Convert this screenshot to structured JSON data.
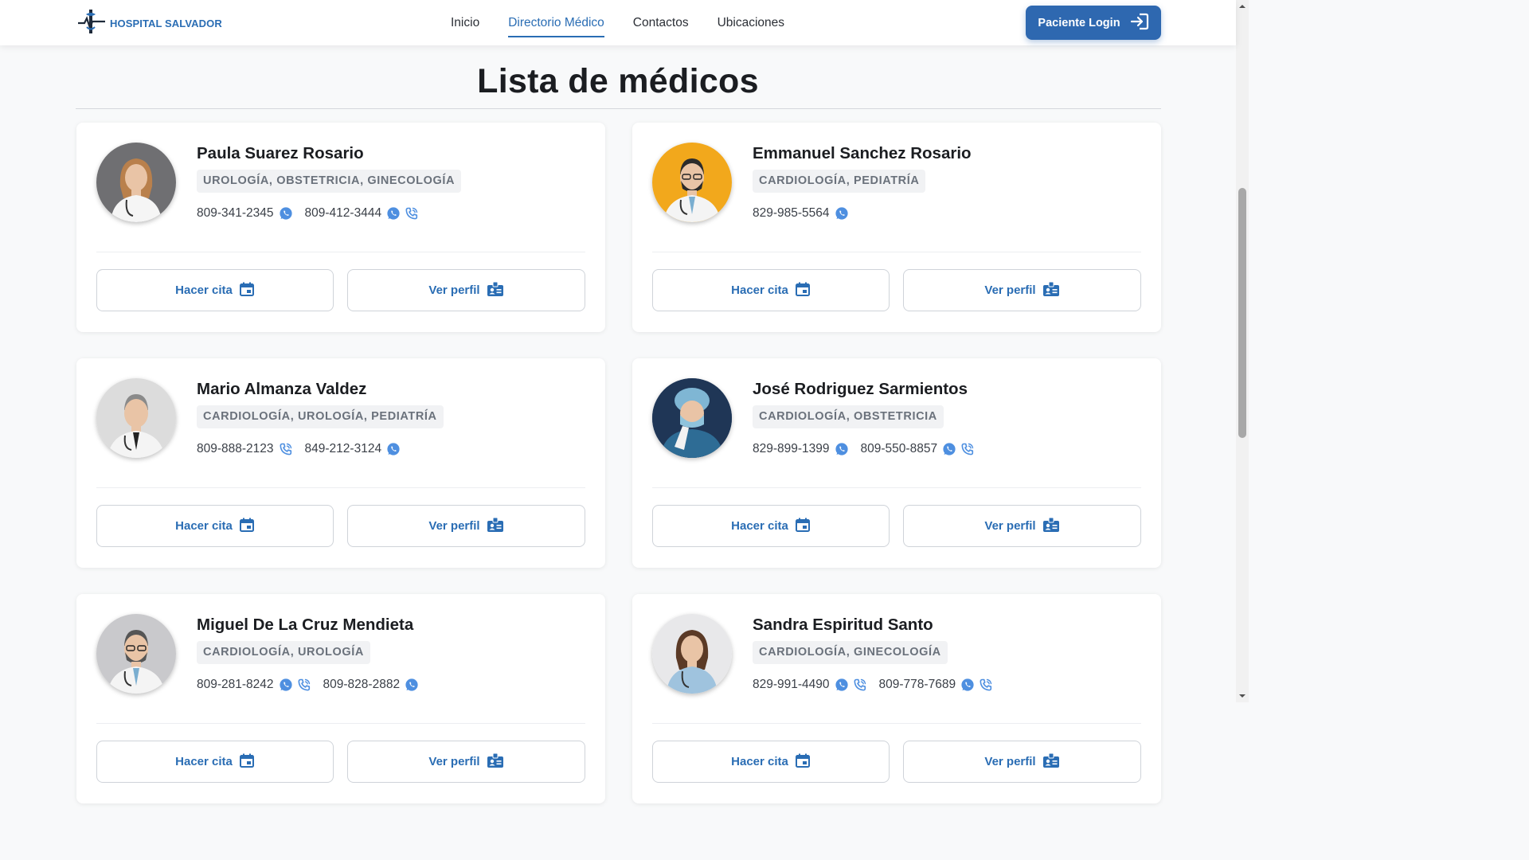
{
  "brand": {
    "name": "HOSPITAL SALVADOR",
    "color": "#2a6db4"
  },
  "nav": [
    {
      "label": "Inicio",
      "active": false
    },
    {
      "label": "Directorio Médico",
      "active": true
    },
    {
      "label": "Contactos",
      "active": false
    },
    {
      "label": "Ubicaciones",
      "active": false
    }
  ],
  "login": {
    "label": "Paciente Login",
    "icon": "login-arrow-icon"
  },
  "page": {
    "title": "Lista de médicos"
  },
  "buttons": {
    "cita": "Hacer cita",
    "perfil": "Ver perfil"
  },
  "doctors": [
    {
      "name": "Paula Suarez Rosario",
      "specialties": "UROLOGÍA, OBSTETRICIA, GINECOLOGÍA",
      "phones": [
        {
          "number": "809-341-2345",
          "icons": [
            "whatsapp"
          ]
        },
        {
          "number": "809-412-3444",
          "icons": [
            "whatsapp",
            "phone"
          ]
        }
      ],
      "avatar": "female-doctor",
      "avatar_bg": "#6f6f72"
    },
    {
      "name": "Emmanuel Sanchez Rosario",
      "specialties": "CARDIOLOGÍA, PEDIATRÍA",
      "phones": [
        {
          "number": "829-985-5564",
          "icons": [
            "whatsapp"
          ]
        }
      ],
      "avatar": "male-doctor-beard",
      "avatar_bg": "#f2a81c"
    },
    {
      "name": "Mario Almanza Valdez",
      "specialties": "CARDIOLOGÍA, UROLOGÍA, PEDIATRÍA",
      "phones": [
        {
          "number": "809-888-2123",
          "icons": [
            "phone"
          ]
        },
        {
          "number": "849-212-3124",
          "icons": [
            "whatsapp"
          ]
        }
      ],
      "avatar": "male-doctor-grey",
      "avatar_bg": "#dcdcdc"
    },
    {
      "name": "José Rodriguez Sarmientos",
      "specialties": "CARDIOLOGÍA, OBSTETRICIA",
      "phones": [
        {
          "number": "829-899-1399",
          "icons": [
            "whatsapp"
          ]
        },
        {
          "number": "809-550-8857",
          "icons": [
            "whatsapp",
            "phone"
          ]
        }
      ],
      "avatar": "surgeon",
      "avatar_bg": "#2c4e78"
    },
    {
      "name": "Miguel De La Cruz Mendieta",
      "specialties": "CARDIOLOGÍA, UROLOGÍA",
      "phones": [
        {
          "number": "809-281-8242",
          "icons": [
            "whatsapp",
            "phone"
          ]
        },
        {
          "number": "809-828-2882",
          "icons": [
            "whatsapp"
          ]
        }
      ],
      "avatar": "male-doctor-glasses",
      "avatar_bg": "#c9c9cc"
    },
    {
      "name": "Sandra Espiritud Santo",
      "specialties": "CARDIOLOGÍA, GINECOLOGÍA",
      "phones": [
        {
          "number": "829-991-4490",
          "icons": [
            "whatsapp",
            "phone"
          ]
        },
        {
          "number": "809-778-7689",
          "icons": [
            "whatsapp",
            "phone"
          ]
        }
      ],
      "avatar": "female-doctor-scrubs",
      "avatar_bg": "#e8e8ea"
    }
  ]
}
